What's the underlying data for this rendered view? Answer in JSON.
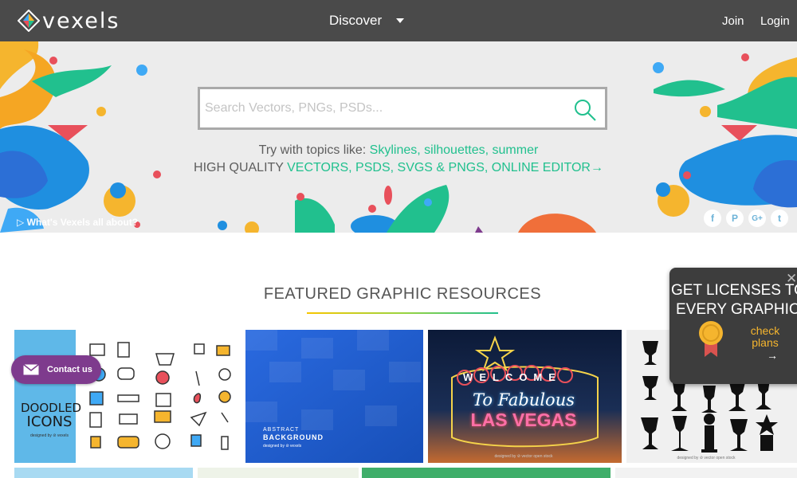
{
  "nav": {
    "logo_text": "vexels",
    "discover_label": "Discover",
    "join_label": "Join",
    "login_label": "Login"
  },
  "hero": {
    "search_placeholder": "Search Vectors, PNGs, PSDs...",
    "topics_prefix": "Try with topics like: ",
    "topics": [
      "Skylines",
      "silhouettes",
      "summer"
    ],
    "quality_prefix": "HIGH QUALITY ",
    "quality_link": "VECTORS, PSDS, SVGS & PNGS, ONLINE EDITOR→",
    "about_link": "▷ What's Vexels all about?",
    "social": [
      "f",
      "P",
      "G+",
      "t"
    ]
  },
  "featured": {
    "title": "FEATURED GRAPHIC RESOURCES",
    "card1": {
      "line1": "DOODLED",
      "line2": "ICONS",
      "credit": "designed by ⊘ vexels"
    },
    "card2": {
      "line1": "ABSTRACT",
      "line2": "BACKGROUND",
      "credit": "designed by ⊘ vexels"
    },
    "card3": {
      "welcome": "WELCOME",
      "to": "To Fabulous",
      "city": "LAS VEGAS",
      "credit": "designed by ⊘ vector open stock"
    },
    "card4": {
      "credit": "designed by ⊘ vector open stock"
    }
  },
  "contact": {
    "label": "Contact us"
  },
  "promo": {
    "line1": "GET LICENSES TO",
    "line2": "EVERY GRAPHIC",
    "link": "check plans",
    "arrow": "→",
    "close": "✕"
  },
  "colors": {
    "nav_bg": "#4a4a4a",
    "accent_green": "#21c08e",
    "contact_purple": "#7e3b8d",
    "promo_orange": "#f5b52e"
  }
}
